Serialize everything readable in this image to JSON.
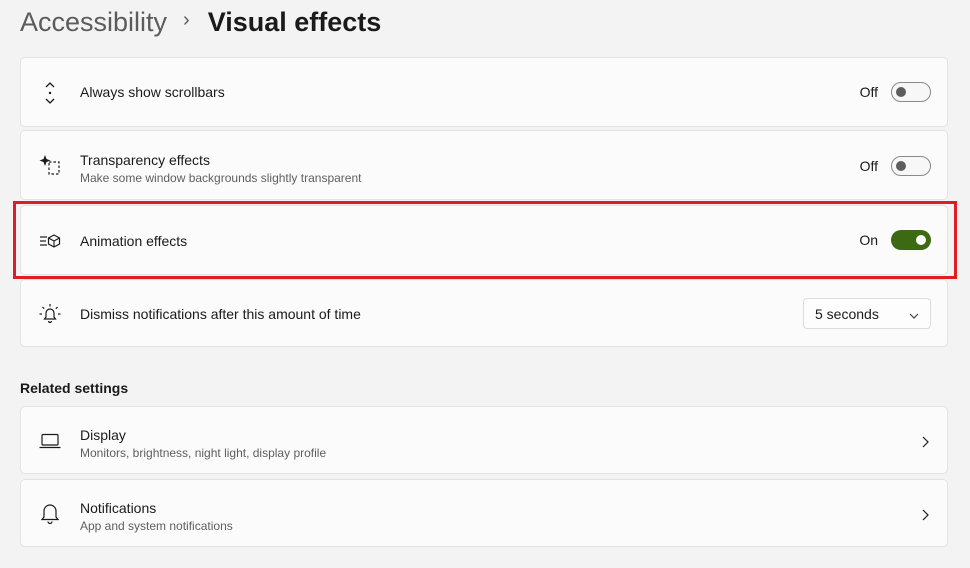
{
  "breadcrumb": {
    "parent": "Accessibility",
    "separator": "›",
    "current": "Visual effects"
  },
  "settings": {
    "scrollbars": {
      "title": "Always show scrollbars",
      "state": "Off",
      "icon": "scrollbar-arrows-icon"
    },
    "transparency": {
      "title": "Transparency effects",
      "subtitle": "Make some window backgrounds slightly transparent",
      "state": "Off",
      "icon": "transparency-sparkle-icon"
    },
    "animation": {
      "title": "Animation effects",
      "state": "On",
      "icon": "animation-effects-icon"
    },
    "notifications_dismiss": {
      "title": "Dismiss notifications after this amount of time",
      "value": "5 seconds",
      "icon": "notification-bell-icon"
    }
  },
  "related": {
    "heading": "Related settings",
    "display": {
      "title": "Display",
      "subtitle": "Monitors, brightness, night light, display profile",
      "icon": "laptop-icon"
    },
    "notifications": {
      "title": "Notifications",
      "subtitle": "App and system notifications",
      "icon": "bell-icon"
    }
  },
  "colors": {
    "toggle_on": "#3b6a12",
    "highlight": "#e01d25",
    "background": "#f3f3f3"
  }
}
